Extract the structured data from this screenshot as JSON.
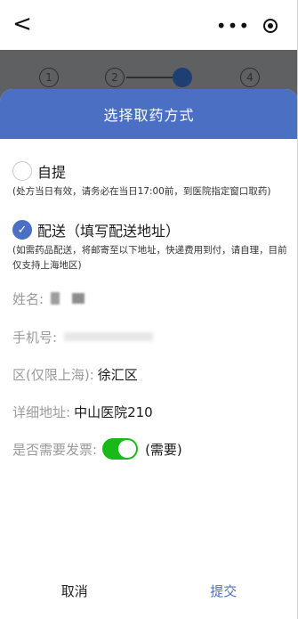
{
  "nav": {
    "back_glyph": "<",
    "more_glyph": "•••"
  },
  "steps": [
    "1",
    "2",
    "3",
    "4"
  ],
  "modal": {
    "title": "选择取药方式",
    "option_pickup": {
      "label": "自提",
      "note": "(处方当日有效，请务必在当日17:00前，到医院指定窗口取药)",
      "selected": false
    },
    "option_delivery": {
      "label": "配送（填写配送地址）",
      "note": "(如需药品配送，将邮寄至以下地址，快递费用到付，请自理，目前仅支持上海地区)",
      "selected": true
    },
    "fields": {
      "name_label": "姓名:",
      "name_value_visible": "i",
      "phone_label": "手机号:",
      "phone_value_visible": "",
      "district_label": "区(仅限上海):",
      "district_value": "徐汇区",
      "address_label": "详细地址:",
      "address_value": "中山医院210",
      "invoice_label": "是否需要发票:",
      "invoice_state_text": "(需要)",
      "invoice_enabled": true
    },
    "buttons": {
      "cancel": "取消",
      "submit": "提交"
    }
  },
  "colors": {
    "header_blue": "#4a6fc3",
    "toggle_green": "#19b919",
    "overlay_gray": "#5f6062",
    "active_step": "#1e3f74"
  },
  "icons": {
    "back": "back-arrow-icon",
    "more": "more-dots-icon",
    "close": "close-target-icon",
    "check": "check-icon"
  }
}
